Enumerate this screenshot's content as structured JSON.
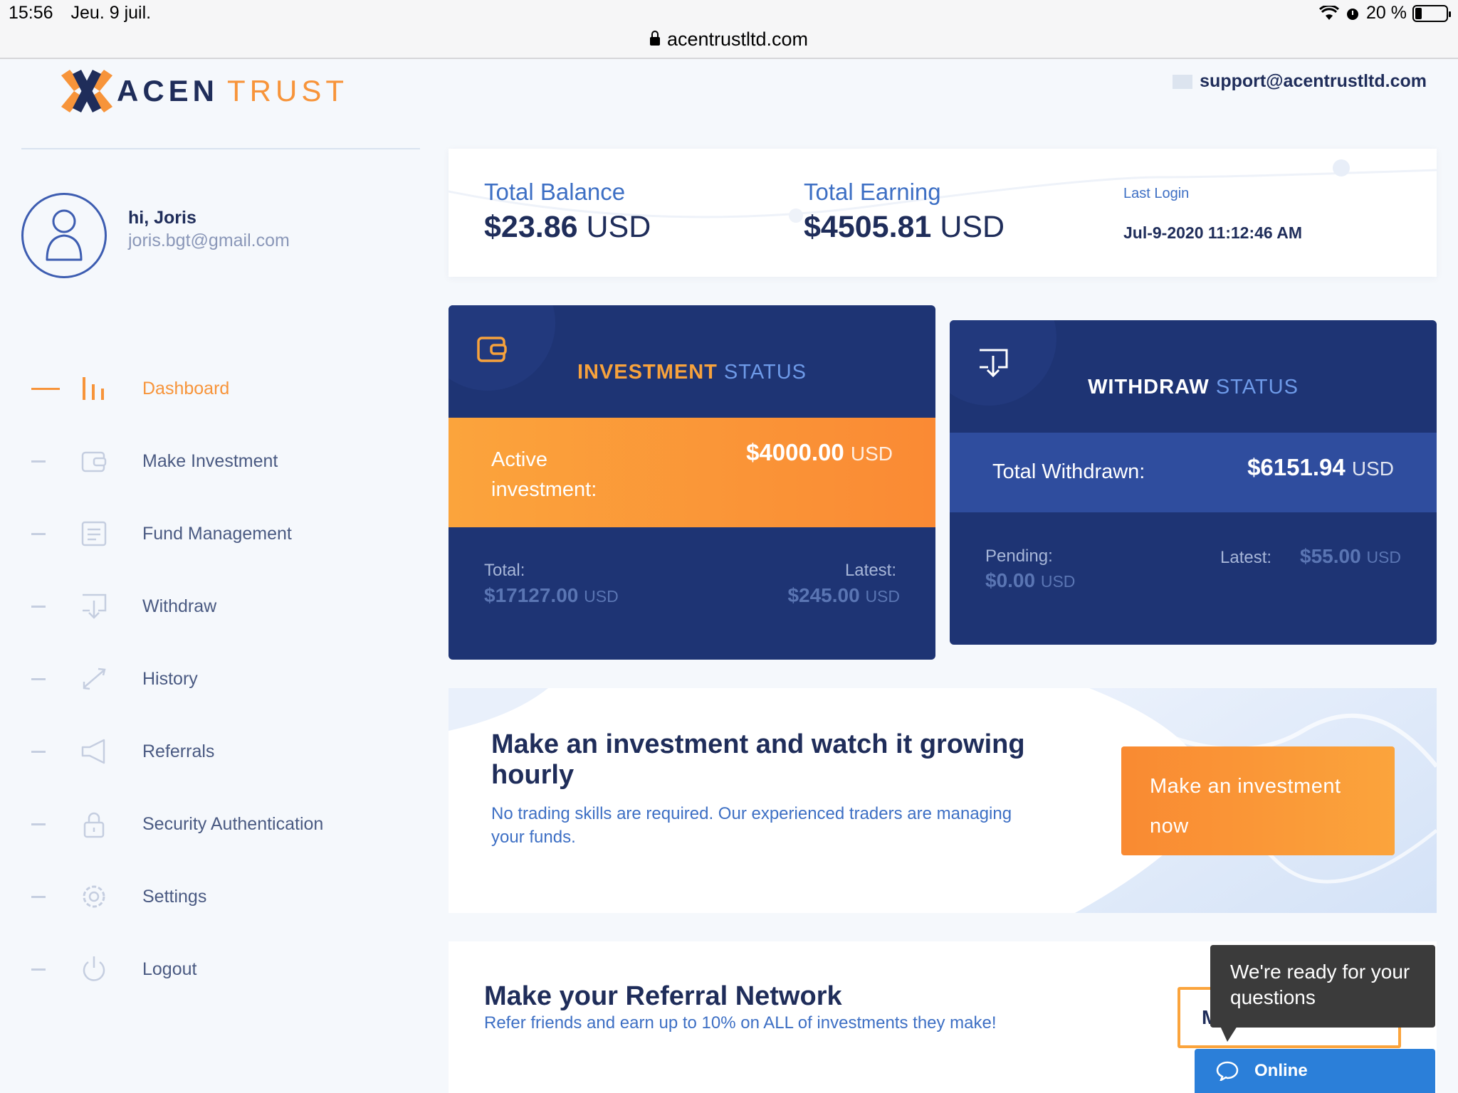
{
  "statusbar": {
    "time": "15:56",
    "date": "Jeu. 9 juil.",
    "battery": "20 %",
    "battery_level": 0.2,
    "url": "acentrustltd.com"
  },
  "brand": {
    "name_part1": "ACEN",
    "name_part2": "TRUST",
    "accent": "#f7943a",
    "navy": "#1f2d5a"
  },
  "header": {
    "support_email": "support@acentrustltd.com"
  },
  "user": {
    "greeting": "hi, Joris",
    "email": "joris.bgt@gmail.com"
  },
  "sidebar": {
    "items": [
      {
        "label": "Dashboard",
        "icon": "bar-chart-icon",
        "active": true
      },
      {
        "label": "Make Investment",
        "icon": "wallet-icon"
      },
      {
        "label": "Fund Management",
        "icon": "document-icon"
      },
      {
        "label": "Withdraw",
        "icon": "withdraw-icon"
      },
      {
        "label": "History",
        "icon": "transfer-arrows-icon"
      },
      {
        "label": "Referrals",
        "icon": "megaphone-icon"
      },
      {
        "label": "Security Authentication",
        "icon": "lock-icon"
      },
      {
        "label": "Settings",
        "icon": "gear-icon"
      },
      {
        "label": "Logout",
        "icon": "power-icon"
      }
    ]
  },
  "summary": {
    "total_balance_label": "Total Balance",
    "total_balance_amount": "$23.86",
    "total_balance_unit": "USD",
    "total_earning_label": "Total Earning",
    "total_earning_amount": "$4505.81",
    "total_earning_unit": "USD",
    "last_login_label": "Last Login",
    "last_login_value": "Jul-9-2020 11:12:46 AM"
  },
  "investment_status": {
    "title_strong": "INVESTMENT",
    "title_light": "STATUS",
    "active_label": "Active investment:",
    "active_amount": "$4000.00",
    "active_unit": "USD",
    "total_label": "Total:",
    "total_amount": "$17127.00",
    "total_unit": "USD",
    "latest_label": "Latest:",
    "latest_amount": "$245.00",
    "latest_unit": "USD"
  },
  "withdraw_status": {
    "title_strong": "WITHDRAW",
    "title_light": "STATUS",
    "total_label": "Total Withdrawn:",
    "total_amount": "$6151.94",
    "total_unit": "USD",
    "pending_label": "Pending:",
    "pending_amount": "$0.00",
    "pending_unit": "USD",
    "latest_label": "Latest:",
    "latest_amount": "$55.00",
    "latest_unit": "USD"
  },
  "promo": {
    "title": "Make an investment and watch it growing hourly",
    "text": "No trading skills are required. Our experienced traders are managing your funds.",
    "button_line1": "Make an investment",
    "button_line2": "now"
  },
  "referral": {
    "title": "Make your Referral Network",
    "text": "Refer friends and earn up to 10% on ALL of investments they make!",
    "button_visible_text": "M"
  },
  "chat": {
    "tooltip": "We're ready for your questions",
    "status": "Online"
  }
}
